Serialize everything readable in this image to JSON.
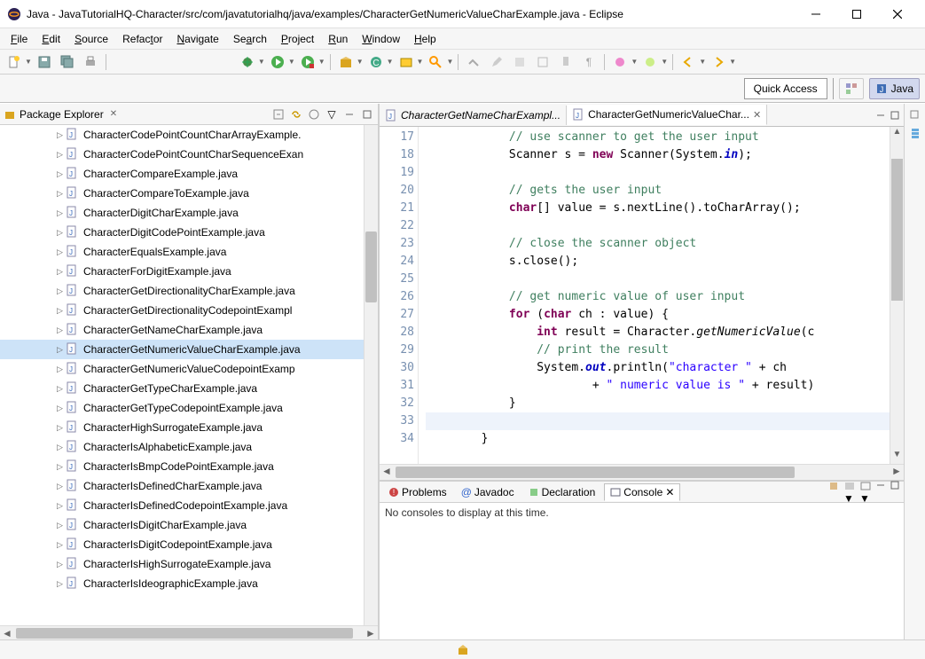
{
  "window": {
    "title": "Java - JavaTutorialHQ-Character/src/com/javatutorialhq/java/examples/CharacterGetNumericValueCharExample.java - Eclipse"
  },
  "menu": {
    "file": "File",
    "edit": "Edit",
    "source": "Source",
    "refactor": "Refactor",
    "navigate": "Navigate",
    "search": "Search",
    "project": "Project",
    "run": "Run",
    "window": "Window",
    "help": "Help"
  },
  "quickaccess": {
    "label": "Quick Access",
    "java": "Java"
  },
  "package_explorer": {
    "title": "Package Explorer",
    "items": [
      "CharacterCodePointCountCharArrayExample.",
      "CharacterCodePointCountCharSequenceExan",
      "CharacterCompareExample.java",
      "CharacterCompareToExample.java",
      "CharacterDigitCharExample.java",
      "CharacterDigitCodePointExample.java",
      "CharacterEqualsExample.java",
      "CharacterForDigitExample.java",
      "CharacterGetDirectionalityCharExample.java",
      "CharacterGetDirectionalityCodepointExampl",
      "CharacterGetNameCharExample.java",
      "CharacterGetNumericValueCharExample.java",
      "CharacterGetNumericValueCodepointExamp",
      "CharacterGetTypeCharExample.java",
      "CharacterGetTypeCodepointExample.java",
      "CharacterHighSurrogateExample.java",
      "CharacterIsAlphabeticExample.java",
      "CharacterIsBmpCodePointExample.java",
      "CharacterIsDefinedCharExample.java",
      "CharacterIsDefinedCodepointExample.java",
      "CharacterIsDigitCharExample.java",
      "CharacterIsDigitCodepointExample.java",
      "CharacterIsHighSurrogateExample.java",
      "CharacterIsIdeographicExample.java"
    ],
    "selected_index": 11
  },
  "editor": {
    "tabs": [
      {
        "label": "CharacterGetNameCharExampl..."
      },
      {
        "label": "CharacterGetNumericValueChar..."
      }
    ],
    "active_tab": 1,
    "first_line_no": 17,
    "lines": [
      [
        {
          "t": "            ",
          "c": ""
        },
        {
          "t": "// use scanner to get the user input",
          "c": "cmt"
        }
      ],
      [
        {
          "t": "            Scanner s = ",
          "c": ""
        },
        {
          "t": "new",
          "c": "kw"
        },
        {
          "t": " Scanner(System.",
          "c": ""
        },
        {
          "t": "in",
          "c": "fldb"
        },
        {
          "t": ");",
          "c": ""
        }
      ],
      [
        {
          "t": "",
          "c": ""
        }
      ],
      [
        {
          "t": "            ",
          "c": ""
        },
        {
          "t": "// gets the user input",
          "c": "cmt"
        }
      ],
      [
        {
          "t": "            ",
          "c": ""
        },
        {
          "t": "char",
          "c": "kw"
        },
        {
          "t": "[] value = s.nextLine().toCharArray();",
          "c": ""
        }
      ],
      [
        {
          "t": "",
          "c": ""
        }
      ],
      [
        {
          "t": "            ",
          "c": ""
        },
        {
          "t": "// close the scanner object",
          "c": "cmt"
        }
      ],
      [
        {
          "t": "            s.close();",
          "c": ""
        }
      ],
      [
        {
          "t": "",
          "c": ""
        }
      ],
      [
        {
          "t": "            ",
          "c": ""
        },
        {
          "t": "// get numeric value of user input",
          "c": "cmt"
        }
      ],
      [
        {
          "t": "            ",
          "c": ""
        },
        {
          "t": "for",
          "c": "kw"
        },
        {
          "t": " (",
          "c": ""
        },
        {
          "t": "char",
          "c": "kw"
        },
        {
          "t": " ch : value) {",
          "c": ""
        }
      ],
      [
        {
          "t": "                ",
          "c": ""
        },
        {
          "t": "int",
          "c": "kw"
        },
        {
          "t": " result = Character.",
          "c": ""
        },
        {
          "t": "getNumericValue",
          "c": "meth"
        },
        {
          "t": "(c",
          "c": ""
        }
      ],
      [
        {
          "t": "                ",
          "c": ""
        },
        {
          "t": "// print the result",
          "c": "cmt"
        }
      ],
      [
        {
          "t": "                System.",
          "c": ""
        },
        {
          "t": "out",
          "c": "fldb"
        },
        {
          "t": ".println(",
          "c": ""
        },
        {
          "t": "\"character \"",
          "c": "str"
        },
        {
          "t": " + ch",
          "c": ""
        }
      ],
      [
        {
          "t": "                        + ",
          "c": ""
        },
        {
          "t": "\" numeric value is \"",
          "c": "str"
        },
        {
          "t": " + result)",
          "c": ""
        }
      ],
      [
        {
          "t": "            }",
          "c": ""
        }
      ],
      [
        {
          "t": "",
          "c": ""
        }
      ],
      [
        {
          "t": "        }",
          "c": ""
        }
      ]
    ],
    "current_line_index": 16
  },
  "bottom": {
    "tabs": {
      "problems": "Problems",
      "javadoc": "Javadoc",
      "declaration": "Declaration",
      "console": "Console"
    },
    "active": "console",
    "console_msg": "No consoles to display at this time."
  }
}
